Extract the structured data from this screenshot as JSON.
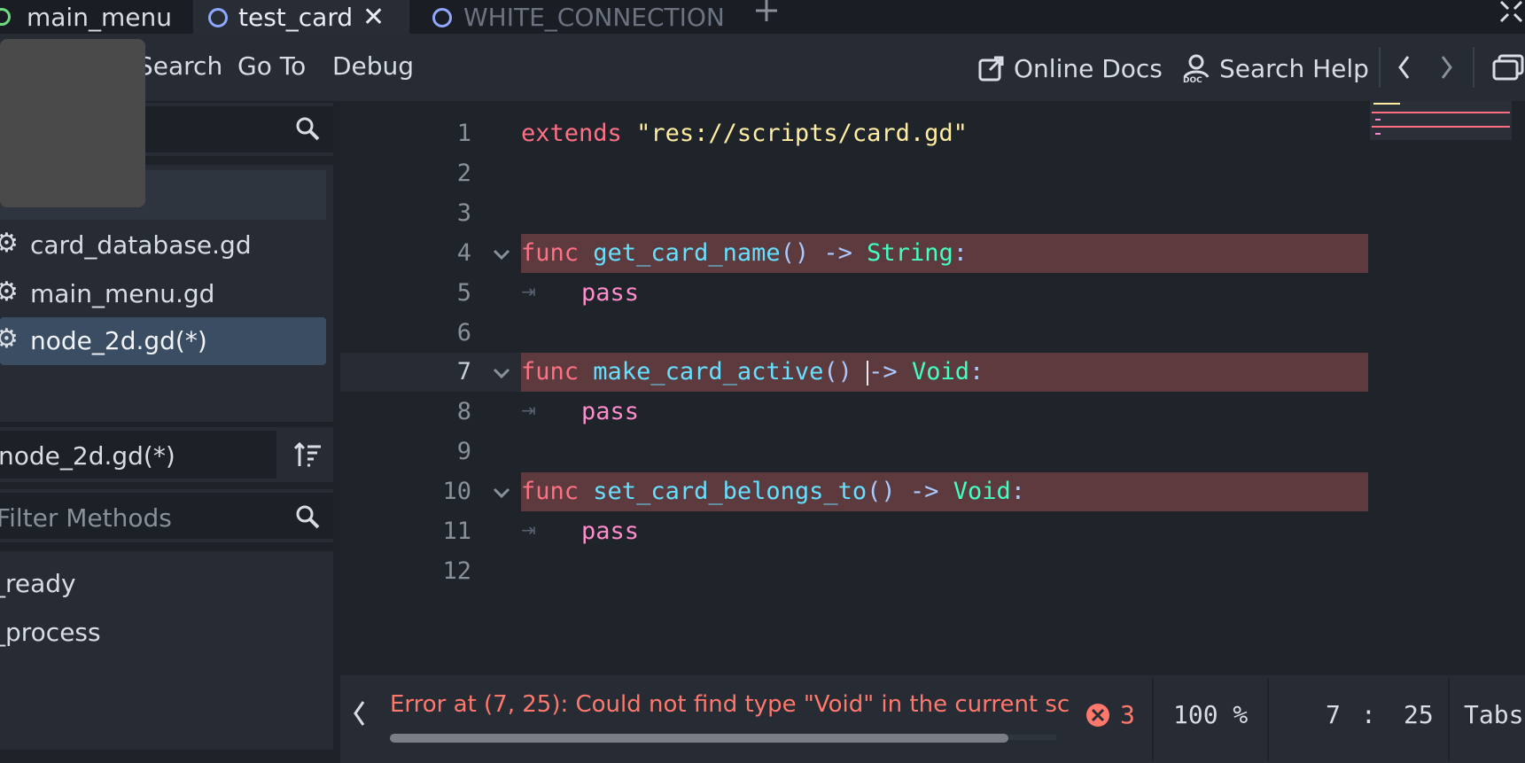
{
  "tabs": [
    {
      "label": "main_menu",
      "color": "#6edc7e"
    },
    {
      "label": "test_card",
      "close": "✕",
      "color": "#8fa7ff"
    },
    {
      "label": "WHITE_CONNECTION",
      "color": "#8fa7ff"
    }
  ],
  "add_tab_icon": "plus-icon",
  "menu": {
    "search": "Search",
    "goto": "Go To",
    "debug": "Debug"
  },
  "toolbar": {
    "online_docs": "Online Docs",
    "search_help": "Search Help"
  },
  "scripts": [
    {
      "name": "card_database.gd"
    },
    {
      "name": "main_menu.gd"
    },
    {
      "name": "node_2d.gd(*)",
      "selected": true
    }
  ],
  "current_script": "node_2d.gd(*)",
  "filter_methods": {
    "placeholder": "Filter Methods"
  },
  "methods": [
    "_ready",
    "_process"
  ],
  "code_lines": [
    "1",
    "2",
    "3",
    "4",
    "5",
    "6",
    "7",
    "8",
    "9",
    "10",
    "11",
    "12"
  ],
  "code": {
    "l1_kw": "extends",
    "l1_str": "\"res://scripts/card.gd\"",
    "l4_kw": "func",
    "l4_fn": "get_card_name",
    "l4_sym1": "() ->",
    "l4_ty": "String",
    "l4_colon": ":",
    "l7_kw": "func",
    "l7_fn": "make_card_active",
    "l7_sym1": "() ",
    "l7_sym2": "->",
    "l7_ty": "Void",
    "l7_colon": ":",
    "l10_kw": "func",
    "l10_fn": "set_card_belongs_to",
    "l10_sym1": "() ->",
    "l10_ty": "Void",
    "l10_colon": ":",
    "pass": "pass"
  },
  "status": {
    "error_text": "Error at (7, 25): Could not find type \"Void\" in the current sc",
    "error_count": "3",
    "zoom": "100 %",
    "line": "7",
    "colon": ":",
    "column": "25",
    "indent": "Tabs"
  },
  "colors": {
    "error_line": "#5c3a3d",
    "selected_item": "#3b4d63",
    "error_text": "#ff786b"
  }
}
